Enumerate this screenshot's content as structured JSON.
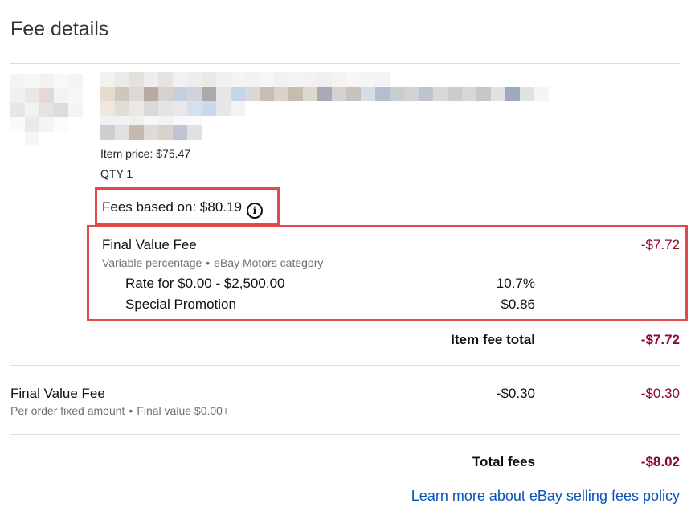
{
  "page": {
    "title": "Fee details"
  },
  "item": {
    "price_label": "Item price: $75.47",
    "qty_label": "QTY 1",
    "fees_based_on_label": "Fees based on: $80.19",
    "info_icon_glyph": "i"
  },
  "final_value_fee": {
    "title": "Final Value Fee",
    "amount": "-$7.72",
    "sub_left": "Variable percentage",
    "sub_right": "eBay Motors category",
    "rate_label": "Rate for $0.00 - $2,500.00",
    "rate_value": "10.7%",
    "promo_label": "Special Promotion",
    "promo_value": "$0.86"
  },
  "item_fee_total": {
    "label": "Item fee total",
    "amount": "-$7.72"
  },
  "order_fee": {
    "title": "Final Value Fee",
    "sub_left": "Per order fixed amount",
    "sub_right": "Final value $0.00+",
    "mid_amount": "-$0.30",
    "amount": "-$0.30"
  },
  "total": {
    "label": "Total fees",
    "amount": "-$8.02"
  },
  "link": {
    "text": "Learn more about eBay selling fees policy"
  },
  "colors": {
    "negative": "#8b0a2a",
    "link": "#0654ba",
    "highlight_box": "#e04a4a"
  }
}
